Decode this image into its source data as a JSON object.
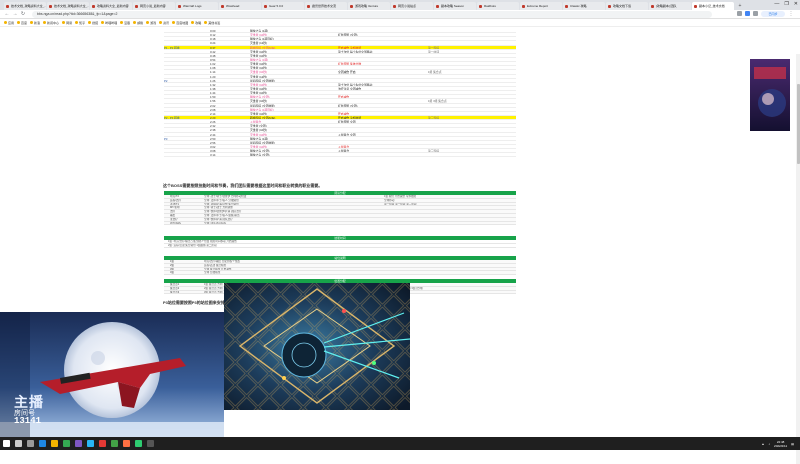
{
  "browser": {
    "tabs": [
      {
        "label": "技术文档_攻略资料大全_...",
        "active": false
      },
      {
        "label": "技术文档_攻略资料大全_...",
        "active": false
      },
      {
        "label": "攻略资料大全_最新内容",
        "active": false
      },
      {
        "label": "网页小说_最新内容",
        "active": false
      },
      {
        "label": "Warcraft Logs",
        "active": false
      },
      {
        "label": "Wowhead",
        "active": false
      },
      {
        "label": "Gear 5.0.0",
        "active": false
      },
      {
        "label": "魔兽世界技术交流",
        "active": false
      },
      {
        "label": "游戏攻略 Venture",
        "active": false
      },
      {
        "label": "网页小说站点",
        "active": false
      },
      {
        "label": "副本攻略 Season",
        "active": false
      },
      {
        "label": "Raidbots",
        "active": false
      },
      {
        "label": "Extreme Report",
        "active": false
      },
      {
        "label": "Classic 攻略",
        "active": false
      },
      {
        "label": "攻略文档下载",
        "active": false
      },
      {
        "label": "[攻略副本] 团队",
        "active": false
      },
      {
        "label": "副本小记_技术文档",
        "active": true
      }
    ],
    "new_tab": "+",
    "window_controls": [
      "—",
      "❐",
      "✕"
    ],
    "address": "bbs.nga.cn/read.php?tid=36665638&_fp=1&page=2",
    "profile_badge": "已同步",
    "bookmarks": [
      "应用",
      "百度",
      "新浪",
      "新闻中心",
      "网易",
      "知乎",
      "搜狐",
      "哔哩哔哩",
      "豆瓣",
      "邮箱",
      "游戏",
      "资讯",
      "百度地图",
      "攻略",
      "其他书签"
    ]
  },
  "sheet": {
    "rows": [
      {
        "c1": "",
        "c2": "0:00",
        "c3": "猴快之鸟 (4项)",
        "c4": "",
        "c5": "",
        "style": ""
      },
      {
        "c1": "",
        "c2": "0:12",
        "c3": "灭世者 (10秒)",
        "c4": "红色预警 (全团)",
        "c5": "",
        "style": ""
      },
      {
        "c1": "",
        "c2": "0:18",
        "c3": "猴快之鸟 (4项目标)",
        "c4": "",
        "c5": "",
        "style": ""
      },
      {
        "c1": "",
        "c2": "0:24",
        "c3": "灭世者 (12秒)",
        "c4": "",
        "c5": "",
        "style": ""
      },
      {
        "c1": "P1 - P2 转换",
        "c2": "0:37",
        "c3": "转换阶段 (全团AOE)",
        "c4": "开启减伤 冷却技能",
        "c5": "第二阶段",
        "style": "hl"
      },
      {
        "c1": "",
        "c2": "0:42",
        "c3": "灭世者 (10秒)",
        "c4": "第十次位 每个先位全部移动",
        "c5": "第一时间",
        "style": ""
      },
      {
        "c1": "",
        "c2": "0:48",
        "c3": "灭世者 (10秒)",
        "c4": "",
        "c5": "",
        "style": ""
      },
      {
        "c1": "",
        "c2": "0:54",
        "c3": "猴快之鸟 (3项)",
        "c4": "",
        "c5": "",
        "style": ""
      },
      {
        "c1": "",
        "c2": "1:02",
        "c3": "灭世者 (10秒)",
        "c4": "红色预警 集体分散",
        "c5": "",
        "style": ""
      },
      {
        "c1": "",
        "c2": "1:08",
        "c3": "灭世者 (10秒)",
        "c4": "",
        "c5": "",
        "style": ""
      },
      {
        "c1": "",
        "c2": "1:14",
        "c3": "灭世者 (10秒)",
        "c4": "全团减伤 开启",
        "c5": "1组 集合点",
        "style": ""
      },
      {
        "c1": "",
        "c2": "1:20",
        "c3": "灭世者 (12秒)",
        "c4": "",
        "c5": "",
        "style": ""
      },
      {
        "c1": "P2",
        "c2": "1:26",
        "c3": "最后阶段 (全团技能)",
        "c4": "",
        "c5": "",
        "style": ""
      },
      {
        "c1": "",
        "c2": "1:32",
        "c3": "灭世者 (10秒)",
        "c4": "第十次位 每个先位全部移动",
        "c5": "",
        "style": ""
      },
      {
        "c1": "",
        "c2": "1:38",
        "c3": "灭世者 (10秒)",
        "c4": "治疗注意 全团减伤",
        "c5": "",
        "style": ""
      },
      {
        "c1": "",
        "c2": "1:44",
        "c3": "灭世者 (10秒)",
        "c4": "",
        "c5": "",
        "style": ""
      },
      {
        "c1": "",
        "c2": "1:50",
        "c3": "猴快之鸟 (全团)",
        "c4": "开启减伤",
        "c5": "",
        "style": ""
      },
      {
        "c1": "",
        "c2": "1:56",
        "c3": "灭世者 (10秒)",
        "c4": "",
        "c5": "1组 3组 集合点",
        "style": ""
      },
      {
        "c1": "",
        "c2": "2:02",
        "c3": "最后阶段 (全团技能)",
        "c4": "红色预警 (全团)",
        "c5": "",
        "style": ""
      },
      {
        "c1": "",
        "c2": "2:08",
        "c3": "猴快之鸟 (4项目标)",
        "c4": "",
        "c5": "",
        "style": ""
      },
      {
        "c1": "",
        "c2": "2:14",
        "c3": "灭世者 (10秒)",
        "c4": "开启减伤",
        "c5": "",
        "style": ""
      },
      {
        "c1": "P2 - P3 转换",
        "c2": "2:20",
        "c3": "转换阶段 (全团AOE)",
        "c4": "开启减伤 冷却技能",
        "c5": "第三阶段",
        "style": "hl"
      },
      {
        "c1": "",
        "c2": "2:26",
        "c3": "入侵集合",
        "c4": "红色预警 全团",
        "c5": "",
        "style": ""
      },
      {
        "c1": "",
        "c2": "2:32",
        "c3": "灭世者 (全团)",
        "c4": "",
        "c5": "",
        "style": ""
      },
      {
        "c1": "",
        "c2": "2:38",
        "c3": "灭世者 (10秒)",
        "c4": "",
        "c5": "",
        "style": ""
      },
      {
        "c1": "",
        "c2": "2:44",
        "c3": "灭世者 (10秒)",
        "c4": "入侵集合 全团",
        "c5": "",
        "style": ""
      },
      {
        "c1": "P3",
        "c2": "2:50",
        "c3": "猴快之鸟 (4项)",
        "c4": "",
        "c5": "",
        "style": ""
      },
      {
        "c1": "",
        "c2": "2:56",
        "c3": "最后阶段 (全团技能)",
        "c4": "",
        "c5": "",
        "style": ""
      },
      {
        "c1": "",
        "c2": "3:02",
        "c3": "灭世者 (10秒)",
        "c4": "入侵集合",
        "c5": "",
        "style": ""
      },
      {
        "c1": "",
        "c2": "3:08",
        "c3": "猴快之鸟 (全团)",
        "c4": "入侵集合",
        "c5": "第三阶段",
        "style": ""
      },
      {
        "c1": "",
        "c2": "3:14",
        "c3": "猴快之鸟 (全团)",
        "c4": "",
        "c5": "",
        "style": ""
      }
    ],
    "paragraph1": "这个BOSS需要按照技能时间和节奏，我们团队需要根据这里时间和职业转换的职业需要。",
    "green_header_1": "团队分配",
    "table1": [
      {
        "g1": "坦克/T2",
        "g2": "全场: 战士/骑士/德鲁伊 方向移动位置",
        "g3": "1组 跑位 开启减伤 冷却技能"
      },
      {
        "g1": "远程/治疗",
        "g2": "全场: 法师/术士/猎人 分散站位",
        "g3": "全场移动"
      },
      {
        "g1": "近战/T1",
        "g2": "全场: 盗贼/萨满/武僧 集合站位",
        "g3": "第一阶段 第二阶段 第三阶段"
      },
      {
        "g1": "MT/主坦",
        "g2": "全场: 骑士/战士 方向调整",
        "g3": ""
      },
      {
        "g1": "治疗",
        "g2": "全场: 牧师/德鲁伊/萨满 团队治疗",
        "g3": ""
      },
      {
        "g1": "输出",
        "g2": "全场: 法师/术士/猎人/盗贼 输出",
        "g3": ""
      },
      {
        "g1": "主治疗",
        "g2": "全场: 牧师/萨满 团队治疗",
        "g3": ""
      },
      {
        "g1": "团长/指挥",
        "g2": "全场: 团队语音指挥",
        "g3": ""
      }
    ],
    "note1": "1组: 坦克/治疗/输出 分配到各个位置 按照时间移动 开启减伤",
    "note2": "2组: 远程/近战 集合站位 1组跟随 第二阶段",
    "green_header_2": "技能时间",
    "green_header_3": "站位说明",
    "table2": [
      {
        "g1": "1组",
        "g2": "坦克/治疗/输出 分配到各个位置",
        "g3": ""
      },
      {
        "g1": "2组",
        "g2": "远程/近战 集合站位",
        "g3": ""
      },
      {
        "g1": "3组",
        "g2": "全场 集合站位 开启减伤",
        "g3": ""
      },
      {
        "g1": "4组",
        "g2": "全场 分散站位",
        "g3": ""
      }
    ],
    "green_header_4": "位置分配",
    "table3": [
      {
        "g1": "集合点1",
        "g2": "1组 集合点 方向",
        "g3": ""
      },
      {
        "g1": "集合点2",
        "g2": "2组 集合点 方向",
        "g3": "1组 (集合点) 2组 (方向) 3组 (方向)"
      },
      {
        "g1": "集合点3",
        "g2": "3组 集合点 方向",
        "g3": ""
      }
    ],
    "paragraph2": "P3站位需要按照P3的站位图来安排站位，先遣的站位图片，根据位置找到站位，然后跟随指挥的站位图标开始。"
  },
  "overlay": {
    "title": "主播",
    "room_label": "房间号",
    "room_number": "13141"
  },
  "taskbar": {
    "time": "22:48",
    "date": "2022/2/11",
    "icons": [
      "start",
      "search",
      "taskview",
      "edge",
      "folder",
      "chrome",
      "store",
      "mail",
      "music",
      "game",
      "video",
      "wechat",
      "obs"
    ]
  },
  "colors": {
    "highlight": "#fff200",
    "green_header": "#17a34a",
    "accent_blue": "#1f4e9f",
    "pink_text": "#e4458d",
    "red_text": "#e02020"
  }
}
